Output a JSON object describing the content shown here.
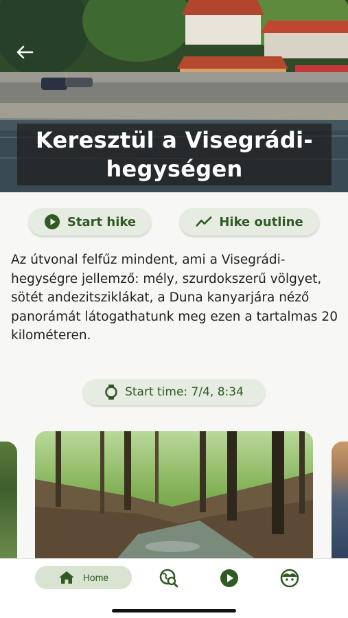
{
  "hero": {
    "title": "Keresztül a Visegrádi-hegységen",
    "back_icon": "arrow-left-icon"
  },
  "actions": {
    "start_hike_label": "Start hike",
    "start_hike_icon": "play-circle-icon",
    "hike_outline_label": "Hike outline",
    "hike_outline_icon": "trend-line-icon"
  },
  "description": "Az útvonal felfűz mindent, ami a Visegrádi-hegységre jellemző: mély, szurdokszerű völgyet, sötét andezitsziklákat, a Duna kanyarjára néző panorámát látogathatunk meg ezen a tartalmas 20 kilométeren.",
  "start_time": {
    "label": "Start time: 7/4, 8:34",
    "icon": "watch-icon"
  },
  "bottom_nav": {
    "items": [
      {
        "label": "Home",
        "icon": "home-icon",
        "active": true
      },
      {
        "label": "",
        "icon": "map-search-icon",
        "active": false
      },
      {
        "label": "",
        "icon": "play-circle-icon",
        "active": false
      },
      {
        "label": "",
        "icon": "face-icon",
        "active": false
      }
    ]
  },
  "colors": {
    "accent": "#2f5a24",
    "pill_bg": "#e6ece1",
    "nav_active_bg": "#d9e3d1",
    "background": "#f7f7f5"
  }
}
